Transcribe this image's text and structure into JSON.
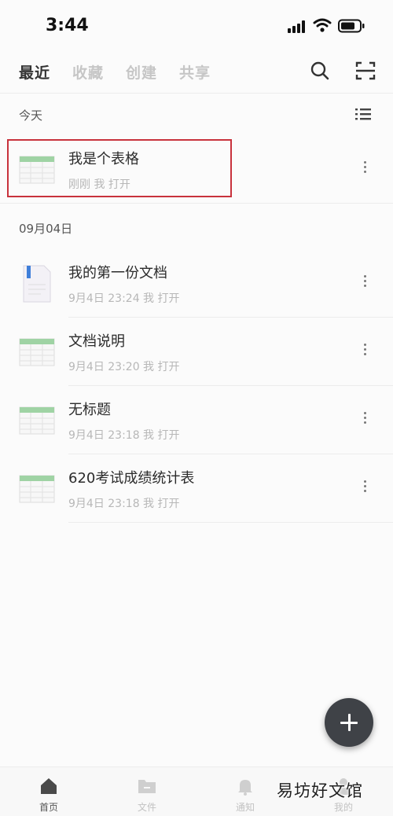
{
  "status_bar": {
    "time": "3:44"
  },
  "header": {
    "tabs": [
      {
        "label": "最近",
        "active": true
      },
      {
        "label": "收藏",
        "active": false
      },
      {
        "label": "创建",
        "active": false
      },
      {
        "label": "共享",
        "active": false
      }
    ],
    "icons": [
      "search-icon",
      "scan-icon"
    ]
  },
  "sections": [
    {
      "title": "今天",
      "items": [
        {
          "name": "我是个表格",
          "meta": "刚刚 我 打开",
          "type": "sheet",
          "highlighted": true
        }
      ]
    },
    {
      "title": "09月04日",
      "items": [
        {
          "name": "我的第一份文档",
          "meta": "9月4日 23:24 我 打开",
          "type": "doc"
        },
        {
          "name": "文档说明",
          "meta": "9月4日 23:20 我 打开",
          "type": "sheet"
        },
        {
          "name": "无标题",
          "meta": "9月4日 23:18 我 打开",
          "type": "sheet"
        },
        {
          "name": "620考试成绩统计表",
          "meta": "9月4日 23:18 我 打开",
          "type": "sheet"
        }
      ]
    }
  ],
  "bottom_nav": [
    {
      "label": "首页",
      "icon": "home-icon",
      "active": true
    },
    {
      "label": "文件",
      "icon": "folder-icon",
      "active": false
    },
    {
      "label": "通知",
      "icon": "bell-icon",
      "active": false
    },
    {
      "label": "我的",
      "icon": "user-icon",
      "active": false
    }
  ],
  "watermark": "易坊好文馆",
  "colors": {
    "highlight": "#c8323c",
    "fab": "#3f4247",
    "sheet_green": "#9fd3a4",
    "doc_blue": "#3f7fd9"
  }
}
